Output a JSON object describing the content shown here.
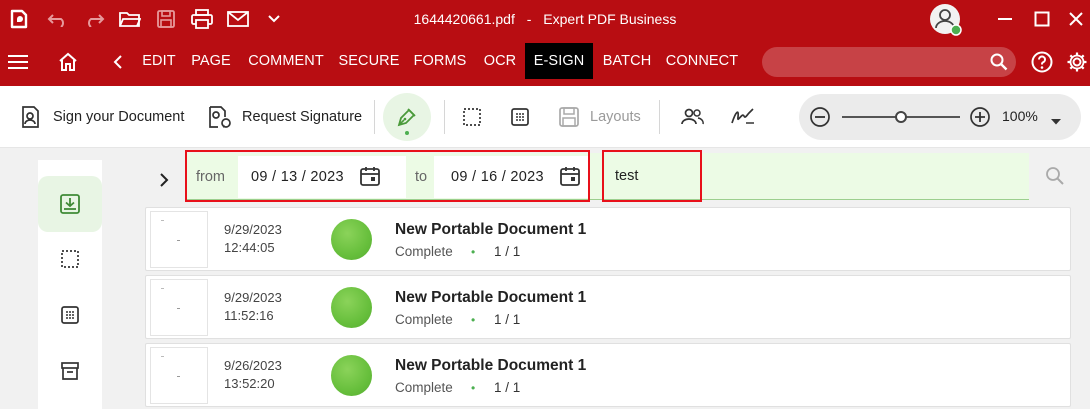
{
  "titlebar": {
    "filename": "1644420661.pdf",
    "separator": "-",
    "app_name": "Expert PDF Business"
  },
  "menu": {
    "tabs": [
      {
        "label": "EDIT"
      },
      {
        "label": "PAGE"
      },
      {
        "label": "COMMENT"
      },
      {
        "label": "SECURE"
      },
      {
        "label": "FORMS"
      },
      {
        "label": "OCR"
      },
      {
        "label": "E-SIGN",
        "active": true
      },
      {
        "label": "BATCH"
      },
      {
        "label": "CONNECT"
      }
    ],
    "search_placeholder": ""
  },
  "toolbar": {
    "sign_document": "Sign your Document",
    "request_signature": "Request Signature",
    "layouts": "Layouts",
    "zoom_value": "100%",
    "zoom_level": 0.5
  },
  "filter": {
    "from_label": "from",
    "from_date": "09 / 13 / 2023",
    "to_label": "to",
    "to_date": "09 / 16 / 2023",
    "search_text": "test"
  },
  "documents": [
    {
      "date": "9/29/2023",
      "time": "12:44:05",
      "title": "New Portable Document 1",
      "status": "Complete",
      "bullet": "•",
      "pages": "1 / 1"
    },
    {
      "date": "9/29/2023",
      "time": "11:52:16",
      "title": "New Portable Document 1",
      "status": "Complete",
      "bullet": "•",
      "pages": "1 / 1"
    },
    {
      "date": "9/26/2023",
      "time": "13:52:20",
      "title": "New Portable Document 1",
      "status": "Complete",
      "bullet": "•",
      "pages": "1 / 1"
    }
  ],
  "colors": {
    "brand_red": "#b80d12",
    "accent_green": "#67bf3c",
    "highlight_red": "#e8101a"
  }
}
